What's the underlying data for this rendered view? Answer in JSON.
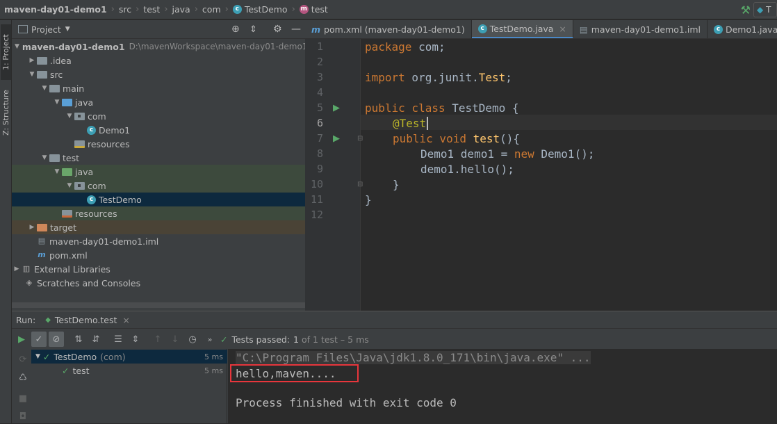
{
  "breadcrumbs": [
    "maven-day01-demo1",
    "src",
    "test",
    "java",
    "com",
    "TestDemo",
    "test"
  ],
  "run_config_label": "T",
  "left_strip": {
    "project": "1: Project",
    "structure": "Z: Structure"
  },
  "project_panel": {
    "title": "Project",
    "tree": [
      {
        "label": "maven-day01-demo1",
        "extra": "D:\\mavenWorkspace\\maven-day01-demo1"
      },
      {
        "label": ".idea"
      },
      {
        "label": "src"
      },
      {
        "label": "main"
      },
      {
        "label": "java"
      },
      {
        "label": "com"
      },
      {
        "label": "Demo1"
      },
      {
        "label": "resources"
      },
      {
        "label": "test"
      },
      {
        "label": "java"
      },
      {
        "label": "com"
      },
      {
        "label": "TestDemo"
      },
      {
        "label": "resources"
      },
      {
        "label": "target"
      },
      {
        "label": "maven-day01-demo1.iml"
      },
      {
        "label": "pom.xml"
      },
      {
        "label": "External Libraries"
      },
      {
        "label": "Scratches and Consoles"
      }
    ]
  },
  "editor": {
    "tabs": [
      {
        "label": "pom.xml (maven-day01-demo1)"
      },
      {
        "label": "TestDemo.java"
      },
      {
        "label": "maven-day01-demo1.iml"
      },
      {
        "label": "Demo1.java"
      }
    ],
    "line_numbers": [
      "1",
      "2",
      "3",
      "4",
      "5",
      "6",
      "7",
      "8",
      "9",
      "10",
      "11",
      "12"
    ],
    "code": {
      "l1_kw": "package",
      "l1_rest": " com;",
      "l3_kw": "import",
      "l3_a": " org.junit.",
      "l3_cls": "Test",
      "l3_b": ";",
      "l5_kw": "public class",
      "l5_rest": " TestDemo {",
      "l6_ann": "@Test",
      "l7_kw": "public void",
      "l7_sp": " ",
      "l7_fn": "test",
      "l7_rest": "(){",
      "l8_a": "Demo1 demo1 = ",
      "l8_kw": "new",
      "l8_b": " Demo1();",
      "l9": "demo1.hello();",
      "l10": "}",
      "l11": "}"
    }
  },
  "run": {
    "label": "Run:",
    "tab": "TestDemo.test",
    "status_prefix": "Tests passed:",
    "status_count": "1",
    "status_suffix": "of 1 test – 5 ms",
    "tests": [
      {
        "name": "TestDemo",
        "pkg": "(com)",
        "time": "5 ms"
      },
      {
        "name": "test",
        "pkg": "",
        "time": "5 ms"
      }
    ],
    "console": [
      "\"C:\\Program Files\\Java\\jdk1.8.0_171\\bin\\java.exe\" ...",
      "hello,maven....",
      "",
      "Process finished with exit code 0"
    ]
  },
  "colors": {
    "accent": "#4a88c7",
    "highlight_box": "#e8363c",
    "pass_green": "#59a869"
  }
}
